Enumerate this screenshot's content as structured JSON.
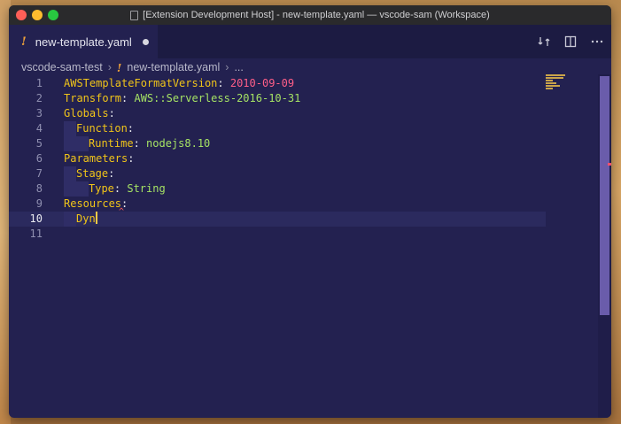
{
  "window": {
    "title": "[Extension Development Host] - new-template.yaml — vscode-sam (Workspace)"
  },
  "tab": {
    "icon": "!",
    "label": "new-template.yaml"
  },
  "breadcrumbs": {
    "folder": "vscode-sam-test",
    "separator": "›",
    "file_icon": "!",
    "file": "new-template.yaml",
    "more": "..."
  },
  "editor": {
    "line_numbers": [
      "1",
      "2",
      "3",
      "4",
      "5",
      "6",
      "7",
      "8",
      "9",
      "10",
      "11"
    ],
    "lines": {
      "l1_key": "AWSTemplateFormatVersion",
      "l1_colon": ": ",
      "l1_val": "2010-09-09",
      "l2_key": "Transform",
      "l2_colon": ": ",
      "l2_val": "AWS::Serverless-2016-10-31",
      "l3_key": "Globals",
      "l3_colon": ":",
      "l4_key": "Function",
      "l4_colon": ":",
      "l5_key": "Runtime",
      "l5_colon": ": ",
      "l5_val": "nodejs8.10",
      "l6_key": "Parameters",
      "l6_colon": ":",
      "l7_key": "Stage",
      "l7_colon": ":",
      "l8_key": "Type",
      "l8_colon": ": ",
      "l8_val": "String",
      "l9_key": "Resources",
      "l9_colon": ":",
      "l10_text": "Dyn"
    },
    "squiggle": "^",
    "current_line": 10
  },
  "colors": {
    "editor_bg": "#232150",
    "key": "#f0c419",
    "string_red": "#ff5f88",
    "string_green": "#a5e264",
    "cursor": "#f7c948"
  },
  "icons": [
    "open-changes-icon",
    "split-editor-icon",
    "more-actions-icon"
  ]
}
